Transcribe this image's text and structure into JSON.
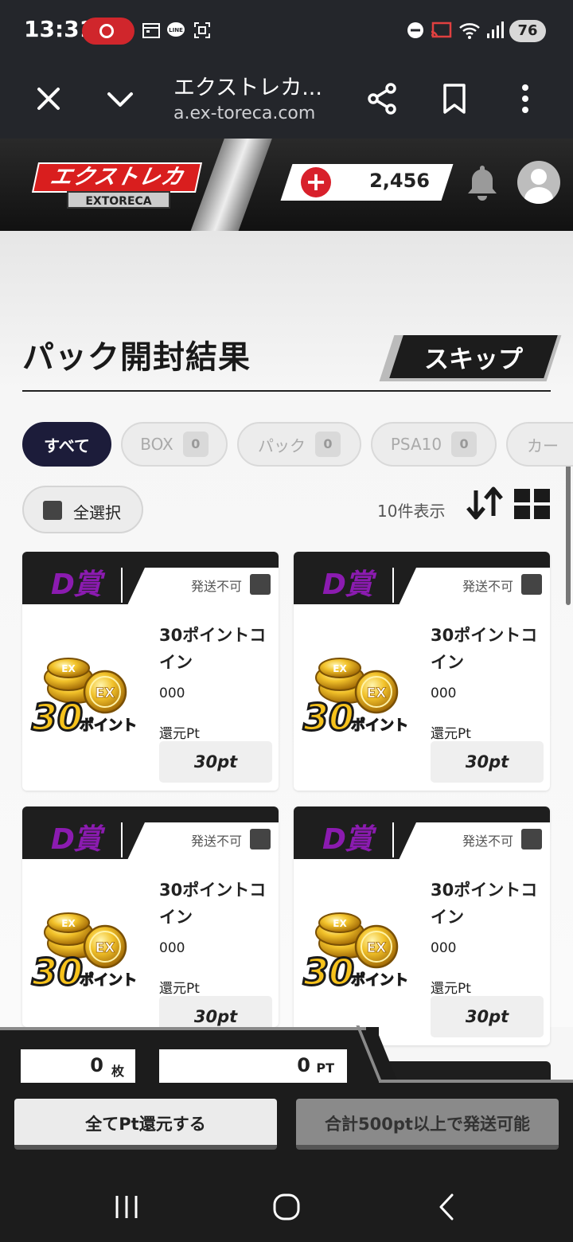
{
  "status_bar": {
    "time": "13:31",
    "battery": "76",
    "icons": [
      "record-icon",
      "calendar-icon",
      "line-icon",
      "screenshot-icon",
      "dnd-icon",
      "cast-icon",
      "wifi-icon",
      "signal-icon"
    ]
  },
  "browser": {
    "title": "エクストレカ...",
    "url": "a.ex-toreca.com"
  },
  "header": {
    "logo_text": "エクストレカ",
    "logo_sub": "EXTORECA",
    "points": "2,456",
    "accent": "#d8202b"
  },
  "page": {
    "title": "パック開封結果",
    "skip_label": "スキップ",
    "filters": [
      {
        "label": "すべて",
        "count": ""
      },
      {
        "label": "BOX",
        "count": "0"
      },
      {
        "label": "パック",
        "count": "0"
      },
      {
        "label": "PSA10",
        "count": "0"
      },
      {
        "label": "カー",
        "count": ""
      }
    ],
    "select_all": "全選択",
    "result_count": "10件表示"
  },
  "cards": [
    {
      "rank": "D賞",
      "no_ship": "発送不可",
      "name": "30ポイントコイン",
      "code": "000",
      "return_label": "還元Pt",
      "return_value": "30pt",
      "coin_num": "30",
      "coin_text": "ポイント",
      "coin_ex": "EX"
    },
    {
      "rank": "D賞",
      "no_ship": "発送不可",
      "name": "30ポイントコイン",
      "code": "000",
      "return_label": "還元Pt",
      "return_value": "30pt",
      "coin_num": "30",
      "coin_text": "ポイント",
      "coin_ex": "EX"
    },
    {
      "rank": "D賞",
      "no_ship": "発送不可",
      "name": "30ポイントコイン",
      "code": "000",
      "return_label": "還元Pt",
      "return_value": "30pt",
      "coin_num": "30",
      "coin_text": "ポイント",
      "coin_ex": "EX"
    },
    {
      "rank": "D賞",
      "no_ship": "発送不可",
      "name": "30ポイントコイン",
      "code": "000",
      "return_label": "還元Pt",
      "return_value": "30pt",
      "coin_num": "30",
      "coin_text": "ポイント",
      "coin_ex": "EX"
    }
  ],
  "summary": {
    "count_value": "0",
    "count_unit": "枚",
    "pt_value": "0",
    "pt_unit": "PT"
  },
  "actions": {
    "return_all": "全てPt還元する",
    "ship_disabled": "合計500pt以上で発送可能"
  }
}
